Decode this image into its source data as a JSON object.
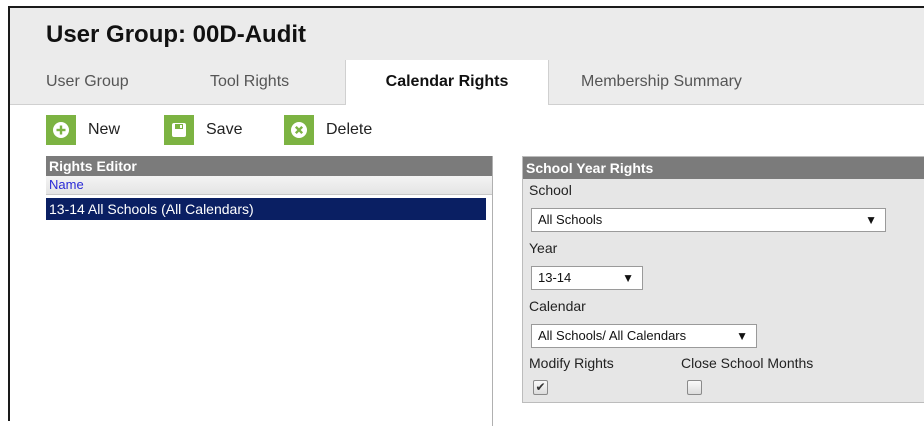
{
  "header": {
    "title": "User Group: 00D-Audit"
  },
  "tabs": [
    {
      "label": "User Group"
    },
    {
      "label": "Tool Rights"
    },
    {
      "label": "Calendar Rights",
      "active": true
    },
    {
      "label": "Membership Summary"
    }
  ],
  "toolbar": {
    "new_label": "New",
    "save_label": "Save",
    "delete_label": "Delete"
  },
  "rights_editor": {
    "title": "Rights Editor",
    "column_header": "Name",
    "rows": [
      {
        "name": "13-14 All Schools (All Calendars)",
        "selected": true
      }
    ]
  },
  "school_year_rights": {
    "title": "School Year Rights",
    "school_label": "School",
    "school_value": "All Schools",
    "year_label": "Year",
    "year_value": "13-14",
    "calendar_label": "Calendar",
    "calendar_value": "All Schools/ All Calendars",
    "modify_rights_label": "Modify Rights",
    "modify_rights_checked": true,
    "close_school_months_label": "Close School Months",
    "close_school_months_checked": false
  },
  "colors": {
    "accent_green": "#7cb342",
    "selected_row": "#0a1f63",
    "panel_header": "#7b7b7b"
  }
}
